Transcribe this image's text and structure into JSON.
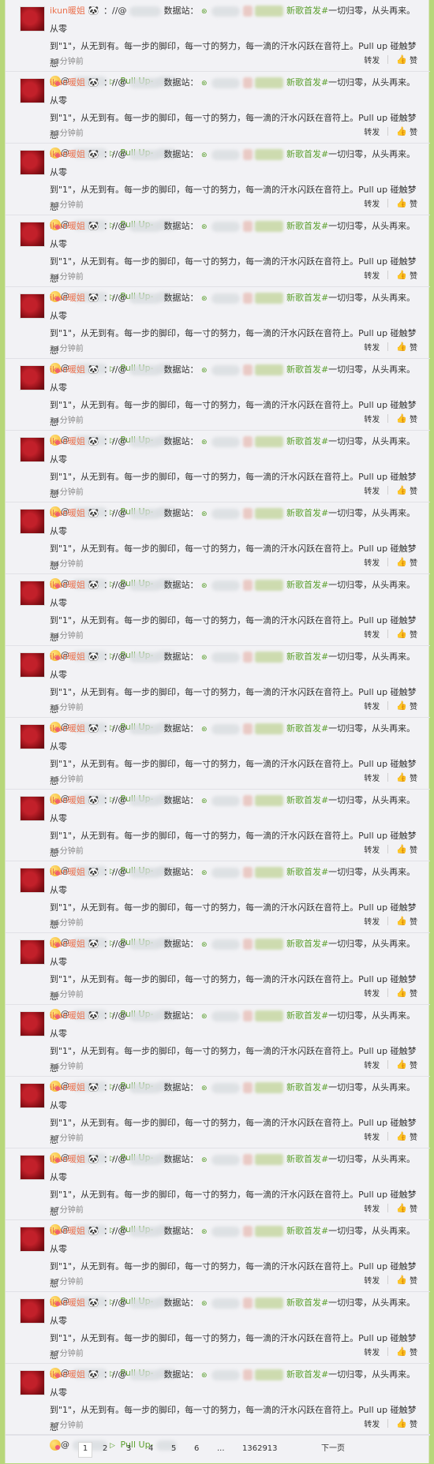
{
  "comment_template": {
    "username": "ikun暖姐",
    "prefix": "：//@",
    "site_label": "数据站：",
    "link_mark": "⊛",
    "tag_text": "新歌首发#",
    "text_part1": "一切归零，从头再来。从零",
    "text_part2": "到\"1\"，从无到有。每一步的脚印，每一寸的努力，每一滴的汗水闪跃在音符上。Pull up 碰触梦想",
    "at_mark": "@",
    "link_label": "Pull Up-",
    "repost_label": "转发",
    "like_label": "赞"
  },
  "comments": [
    {
      "time": "23分钟前"
    },
    {
      "time": "23分钟前"
    },
    {
      "time": "23分钟前"
    },
    {
      "time": "24分钟前"
    },
    {
      "time": "24分钟前"
    },
    {
      "time": "24分钟前"
    },
    {
      "time": "24分钟前"
    },
    {
      "time": "24分钟前"
    },
    {
      "time": "24分钟前"
    },
    {
      "time": "25分钟前"
    },
    {
      "time": "25分钟前"
    },
    {
      "time": "25分钟前"
    },
    {
      "time": "26分钟前"
    },
    {
      "time": "26分钟前"
    },
    {
      "time": "26分钟前"
    },
    {
      "time": "27分钟前"
    },
    {
      "time": "27分钟前"
    },
    {
      "time": "27分钟前"
    },
    {
      "time": "27分钟前"
    },
    {
      "time": "27分钟前"
    }
  ],
  "pagination": {
    "pages": [
      "1",
      "2",
      "3",
      "4",
      "5",
      "6"
    ],
    "ellipsis": "...",
    "last_page": "1362913",
    "next_label": "下一页",
    "current": "1"
  },
  "colors": {
    "frame": "#b7d77a",
    "username": "#eb7350",
    "link": "#5a9e2c",
    "panel": "#f2f2f5"
  },
  "icons": {
    "panda": "panda-emoji-icon",
    "emoji": "blush-emoji-icon",
    "link": "play-link-icon",
    "like": "thumbs-up-icon"
  }
}
